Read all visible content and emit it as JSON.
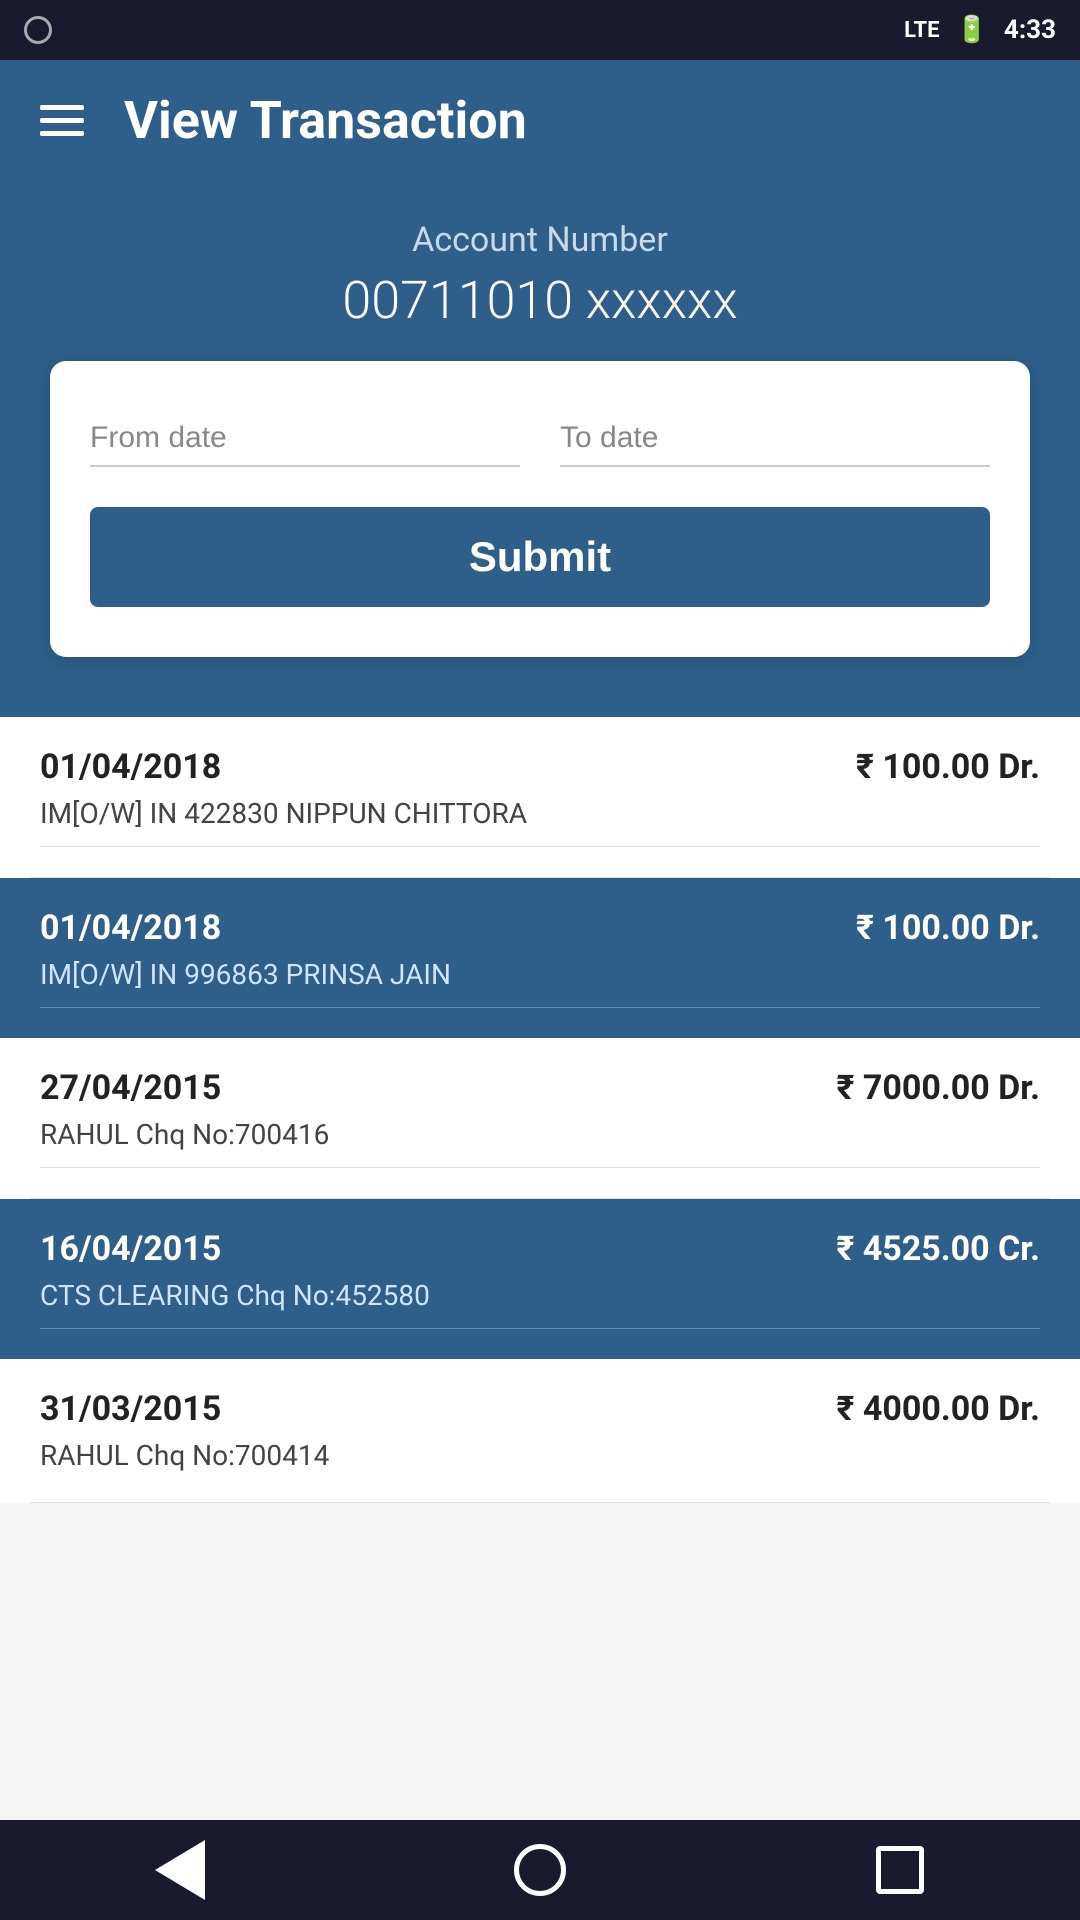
{
  "statusBar": {
    "time": "4:33"
  },
  "navBar": {
    "title": "View Transaction",
    "menuIcon": "hamburger-icon"
  },
  "accountSection": {
    "label": "Account Number",
    "number": "00711010 xxxxxx"
  },
  "filterCard": {
    "fromDatePlaceholder": "From date",
    "toDatePlaceholder": "To date",
    "submitLabel": "Submit"
  },
  "transactions": [
    {
      "date": "01/04/2018",
      "amount": "₹ 100.00 Dr.",
      "description": "IM[O/W] IN 422830 NIPPUN CHITTORA",
      "highlighted": false
    },
    {
      "date": "01/04/2018",
      "amount": "₹ 100.00 Dr.",
      "description": "IM[O/W] IN 996863 PRINSA JAIN",
      "highlighted": true
    },
    {
      "date": "27/04/2015",
      "amount": "₹ 7000.00 Dr.",
      "description": "RAHUL Chq No:700416",
      "highlighted": false
    },
    {
      "date": "16/04/2015",
      "amount": "₹ 4525.00 Cr.",
      "description": "CTS CLEARING Chq No:452580",
      "highlighted": true
    },
    {
      "date": "31/03/2015",
      "amount": "₹ 4000.00 Dr.",
      "description": "RAHUL Chq No:700414",
      "highlighted": false
    }
  ],
  "bottomNav": {
    "backLabel": "back",
    "homeLabel": "home",
    "recentLabel": "recent"
  }
}
